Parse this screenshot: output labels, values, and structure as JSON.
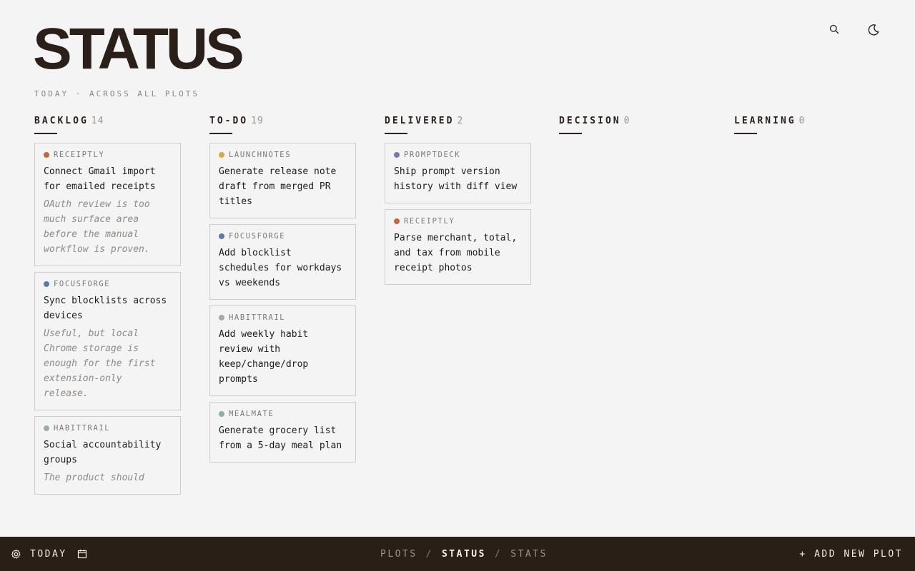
{
  "header": {
    "title": "STATUS",
    "subtitle": "TODAY · ACROSS ALL PLOTS",
    "search_icon": "search-icon",
    "theme_icon": "moon-icon"
  },
  "columns": [
    {
      "name": "BACKLOG",
      "count": "14",
      "cards": [
        {
          "plot": "RECEIPTLY",
          "color": "#c0673e",
          "title": "Connect Gmail import for emailed receipts",
          "note": "OAuth review is too much surface area before the manual workflow is proven."
        },
        {
          "plot": "FOCUSFORGE",
          "color": "#5b79ad",
          "title": "Sync blocklists across devices",
          "note": "Useful, but local Chrome storage is enough for the first extension-only release."
        },
        {
          "plot": "HABITTRAIL",
          "color": "#9fb09a",
          "title": "Social accountability groups",
          "note": "The product should"
        }
      ]
    },
    {
      "name": "TO-DO",
      "count": "19",
      "cards": [
        {
          "plot": "LAUNCHNOTES",
          "color": "#d6a850",
          "title": "Generate release note draft from merged PR titles",
          "note": ""
        },
        {
          "plot": "FOCUSFORGE",
          "color": "#5b79ad",
          "title": "Add blocklist schedules for workdays vs weekends",
          "note": ""
        },
        {
          "plot": "HABITTRAIL",
          "color": "#9fb09a",
          "title": "Add weekly habit review with keep/change/drop prompts",
          "note": ""
        },
        {
          "plot": "MEALMATE",
          "color": "#8fb0a0",
          "title": "Generate grocery list from a 5-day meal plan",
          "note": ""
        }
      ]
    },
    {
      "name": "DELIVERED",
      "count": "2",
      "cards": [
        {
          "plot": "PROMPTDECK",
          "color": "#7a76b0",
          "title": "Ship prompt version history with diff view",
          "note": ""
        },
        {
          "plot": "RECEIPTLY",
          "color": "#c0673e",
          "title": "Parse merchant, total, and tax from mobile receipt photos",
          "note": ""
        }
      ]
    },
    {
      "name": "DECISION",
      "count": "0",
      "cards": []
    },
    {
      "name": "LEARNING",
      "count": "0",
      "cards": []
    }
  ],
  "footer": {
    "settings_icon": "gear-icon",
    "today_label": "TODAY",
    "calendar_icon": "calendar-icon",
    "nav": [
      "PLOTS",
      "STATUS",
      "STATS"
    ],
    "active_nav": "STATUS",
    "add_label": "+ ADD NEW PLOT"
  }
}
